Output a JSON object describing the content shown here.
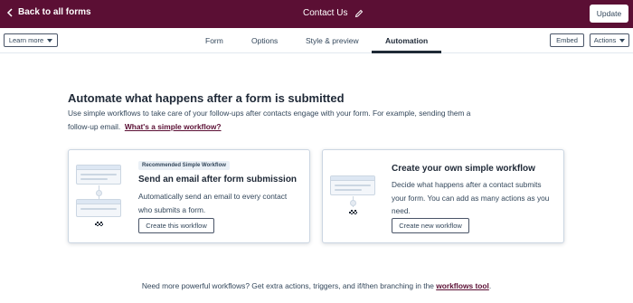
{
  "topbar": {
    "back_label": "Back to all forms",
    "form_name": "Contact Us",
    "update_label": "Update"
  },
  "subbar": {
    "learn_more_label": "Learn more",
    "tabs": [
      {
        "label": "Form"
      },
      {
        "label": "Options"
      },
      {
        "label": "Style & preview"
      },
      {
        "label": "Automation"
      }
    ],
    "active_tab": "Automation",
    "embed_label": "Embed",
    "actions_label": "Actions"
  },
  "main": {
    "title": "Automate what happens after a form is submitted",
    "description": "Use simple workflows to take care of your follow-ups after contacts engage with your form. For example, sending them a follow-up email.",
    "description_link": "What's a simple workflow?"
  },
  "cards": [
    {
      "badge": "Recommended Simple Workflow",
      "title": "Send an email after form submission",
      "description": "Automatically send an email to every contact who submits a form.",
      "button": "Create this workflow"
    },
    {
      "title": "Create your own simple workflow",
      "description": "Decide what happens after a contact submits your form. You can add as many actions as you need.",
      "button": "Create new workflow"
    }
  ],
  "footer": {
    "text": "Need more powerful workflows? Get extra actions, triggers, and if/then branching in the",
    "link": "workflows tool",
    "suffix": "."
  },
  "colors": {
    "brand_bar": "#5b0f34",
    "link": "#5b0f34",
    "text": "#33475b"
  }
}
